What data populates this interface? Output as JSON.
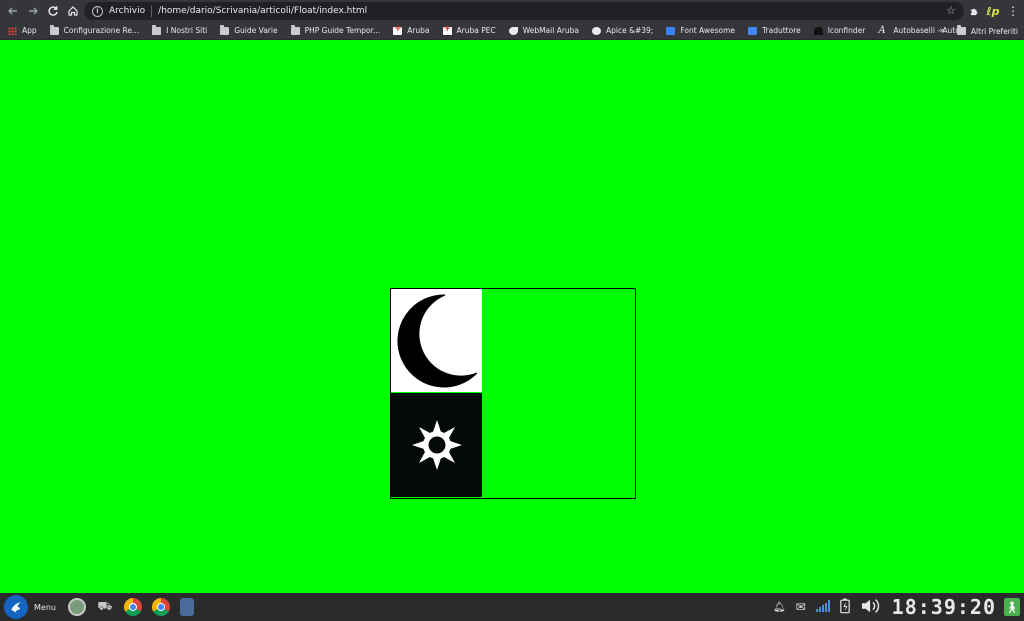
{
  "browser": {
    "scheme_label": "Archivio",
    "url": "/home/dario/Scrivania/articoli/Float/index.html"
  },
  "bookmarks": {
    "items": [
      {
        "label": "App",
        "icon": "apps-grid-icon"
      },
      {
        "label": "Configurazione Re...",
        "icon": "folder-icon"
      },
      {
        "label": "I Nostri Siti",
        "icon": "folder-icon"
      },
      {
        "label": "Guide Varie",
        "icon": "folder-icon"
      },
      {
        "label": "PHP Guide Tempor...",
        "icon": "folder-icon"
      },
      {
        "label": "Aruba",
        "icon": "aruba-icon"
      },
      {
        "label": "Aruba PEC",
        "icon": "aruba-icon"
      },
      {
        "label": "WebMail Aruba",
        "icon": "webmail-icon"
      },
      {
        "label": "Apice &#39;",
        "icon": "globe-icon"
      },
      {
        "label": "Font Awesome",
        "icon": "font-awesome-icon"
      },
      {
        "label": "Traduttore",
        "icon": "translate-icon"
      },
      {
        "label": "Iconfinder",
        "icon": "iconfinder-icon"
      },
      {
        "label": "Autobaselli - Auto...",
        "icon": "autobaselli-icon"
      }
    ],
    "other_label": "Altri Preferiti"
  },
  "page": {
    "background": "#00ff00",
    "tiles": [
      {
        "name": "moon",
        "icon": "moon-icon",
        "background": "#ffffff"
      },
      {
        "name": "sun",
        "icon": "sun-icon",
        "background": "#050808"
      }
    ]
  },
  "taskbar": {
    "menu_label": "Menu",
    "clock": "18:39:20"
  }
}
